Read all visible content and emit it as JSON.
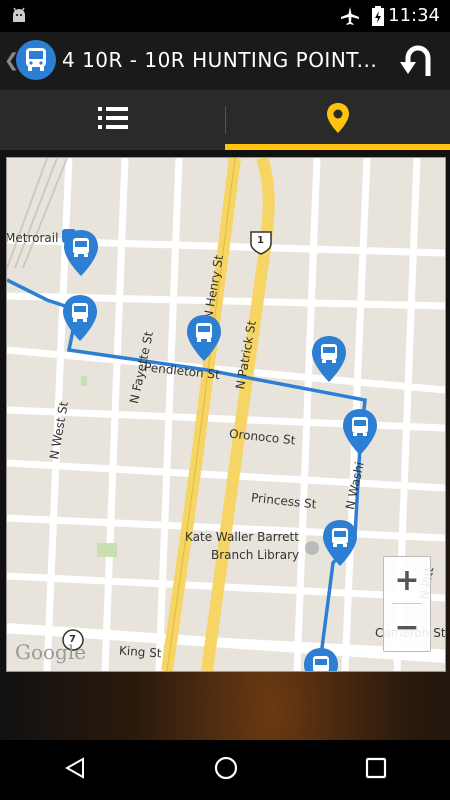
{
  "status_bar": {
    "time": "11:34",
    "icons": [
      "android-icon",
      "airplane-icon",
      "battery-icon"
    ]
  },
  "action_bar": {
    "title": "4  10R - 10R HUNTING POINT...",
    "route_icon": "bus-icon",
    "back_icon": "chevron-left-icon",
    "action_icon": "u-turn-icon"
  },
  "tabs": [
    {
      "name": "list",
      "icon": "list-icon",
      "active": false
    },
    {
      "name": "map",
      "icon": "location-pin-icon",
      "active": true
    }
  ],
  "colors": {
    "accent": "#ffc20e",
    "route_line": "#2d7fd3",
    "pin": "#2d7fd3",
    "road_major": "#f7d564"
  },
  "map": {
    "labels": {
      "metrorail": "Metrorail",
      "n_fayette": "N Fayette St",
      "n_west": "N West St",
      "pendleton": "Pendleton St",
      "n_henry": "N Henry St",
      "n_patrick": "N Patrick St",
      "oronoco": "Oronoco St",
      "princess": "Princess St",
      "library_1": "Kate Waller Barrett",
      "library_2": "Branch Library",
      "n_washington": "N Washi",
      "king": "King St",
      "cameron": "Cameron St",
      "n_pitt": "N Pitt",
      "shield_1": "1",
      "shield_7": "7",
      "google": "Google"
    },
    "zoom_in": "+",
    "zoom_out": "−"
  },
  "nav_bar": {
    "icons": [
      "back-icon",
      "home-icon",
      "recents-icon"
    ]
  }
}
